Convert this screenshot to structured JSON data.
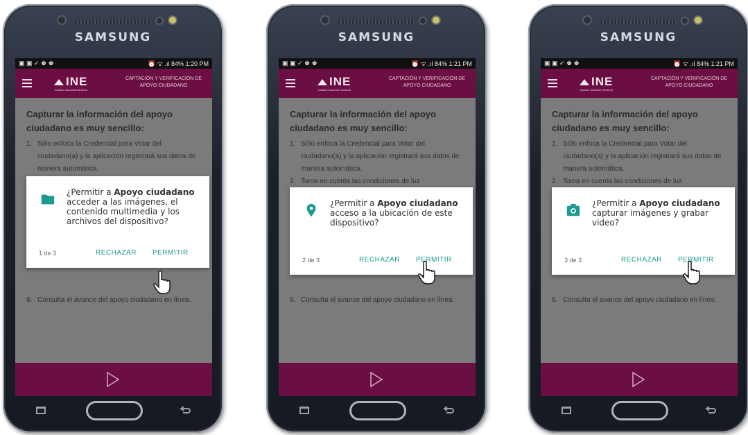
{
  "device_brand": "SAMSUNG",
  "app": {
    "logo_text": "INE",
    "logo_sub": "Instituto Nacional Electoral",
    "title": "CAPTACIÓN Y VERIFICACIÓN DE APOYO CIUDADANO"
  },
  "content": {
    "heading": "Capturar la información del apoyo ciudadano es muy sencillo:",
    "item1_num": "1.",
    "item1_text": "Sólo enfoca la Credencial para Votar del ciudadano(a) y la aplicación registrará sus datos de manera automática.",
    "item2_num": "2.",
    "item2_text": "Toma en cuenta las condiciones de luz",
    "item6_num": "6.",
    "item6_text": "Consulta el avance del apoyo ciudadano en línea."
  },
  "dialog_common": {
    "reject_label": "RECHAZAR",
    "allow_label": "PERMITIR"
  },
  "phones": [
    {
      "status_time": "84% 1:20 PM",
      "dialog_icon": "folder-icon",
      "dialog_pre": "¿Permitir a ",
      "dialog_app": "Apoyo ciudadano",
      "dialog_post": " acceder a las imágenes, el contenido multimedia y los archivos del dispositivo?",
      "dialog_count": "1 de 3"
    },
    {
      "status_time": "84% 1:21 PM",
      "dialog_icon": "location-pin-icon",
      "dialog_pre": "¿Permitir a ",
      "dialog_app": "Apoyo ciudadano",
      "dialog_post": " acceso a la ubicación de este dispositivo?",
      "dialog_count": "2 de 3"
    },
    {
      "status_time": "84% 1:21 PM",
      "dialog_icon": "camera-icon",
      "dialog_pre": "¿Permitir a ",
      "dialog_app": "Apoyo ciudadano",
      "dialog_post": " capturar imágenes y grabar video?",
      "dialog_count": "3 de 3"
    }
  ],
  "colors": {
    "app_bar": "#6b0e43",
    "accent": "#1a9a90",
    "overlay": "#7b7b7b"
  }
}
